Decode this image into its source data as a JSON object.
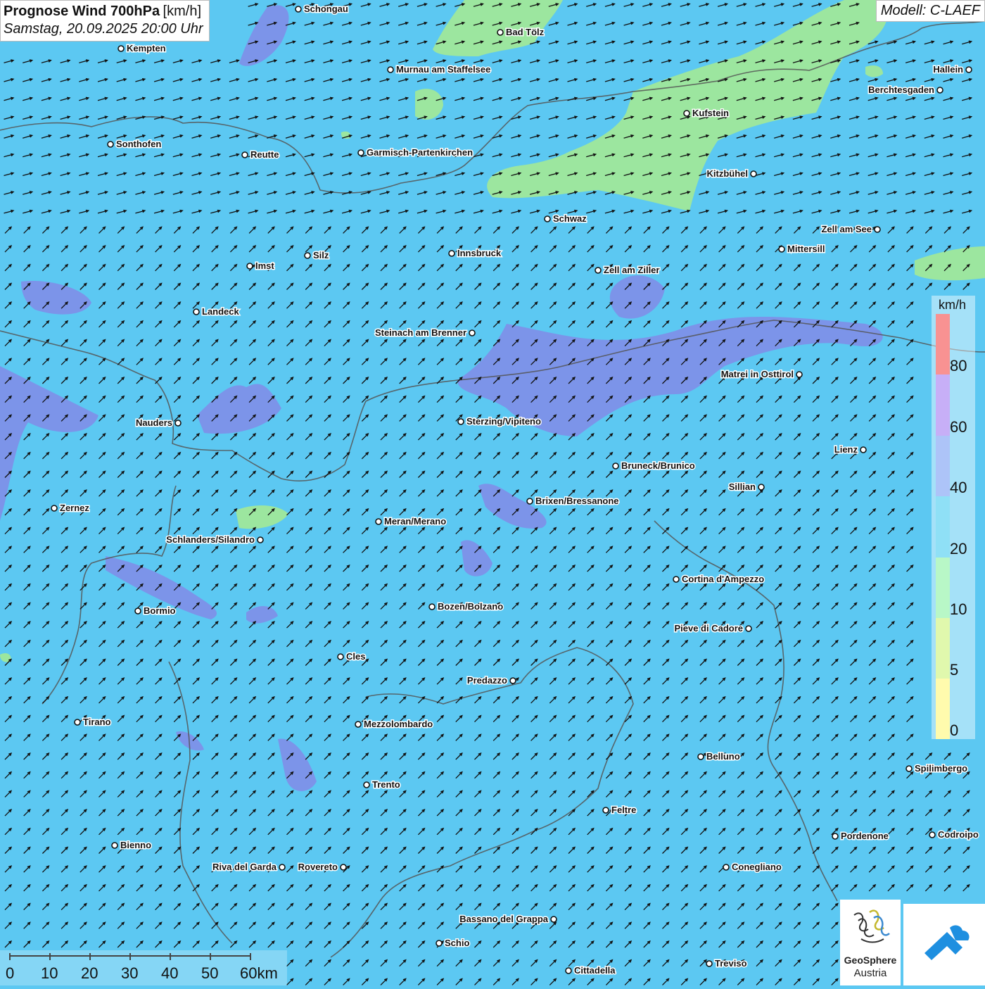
{
  "header": {
    "title": "Prognose Wind 700hPa",
    "unit": "[km/h]",
    "date": "Samstag, 20.09.2025 20:00 Uhr"
  },
  "model": {
    "label": "Modell: C-LAEF"
  },
  "legend": {
    "unit": "km/h",
    "labels": [
      "80",
      "60",
      "40",
      "20",
      "10",
      "5",
      "0"
    ],
    "colors": [
      "#f23a3a",
      "#9a6ef0",
      "#6a94f2",
      "#34c6ef",
      "#7ff09a",
      "#c6f26a",
      "#fff86a"
    ]
  },
  "scalebar": {
    "labels": [
      "0",
      "10",
      "20",
      "30",
      "40",
      "50",
      "60km"
    ]
  },
  "map_colors": {
    "base": "#5cc8f2",
    "wind_20_40": "#7a8ee8",
    "wind_10_20": "#9fe89a",
    "borders": "#555555"
  },
  "cities": [
    "Schongau",
    "Bad Tölz",
    "Kempten",
    "Murnau am Staffelsee",
    "Hallein",
    "Berchtesgaden",
    "Kufstein",
    "Sonthofen",
    "Reutte",
    "Garmisch-Partenkirchen",
    "Kitzbühel",
    "Schwaz",
    "Zell am See",
    "Mittersill",
    "Silz",
    "Innsbruck",
    "Imst",
    "Zell am Ziller",
    "Landeck",
    "Steinach am Brenner",
    "Matrei in Osttirol",
    "Nauders",
    "Sterzing/Vipiteno",
    "Lienz",
    "Bruneck/Brunico",
    "Sillian",
    "Brixen/Bressanone",
    "Zernez",
    "Meran/Merano",
    "Schlanders/Silandro",
    "Cortina d'Ampezzo",
    "Bormio",
    "Bozen/Bolzano",
    "Pieve di Cadore",
    "Cles",
    "Predazzo",
    "Tirano",
    "Mezzolombardo",
    "Belluno",
    "Spilimbergo",
    "Trento",
    "Feltre",
    "Pordenone",
    "Codroipo",
    "Bienno",
    "Riva del Garda",
    "Rovereto",
    "Conegliano",
    "Bassano del Grappa",
    "Schio",
    "Treviso",
    "Cittadella"
  ],
  "logos": {
    "geosphere_name": "GeoSphere",
    "geosphere_sub": "Austria"
  }
}
